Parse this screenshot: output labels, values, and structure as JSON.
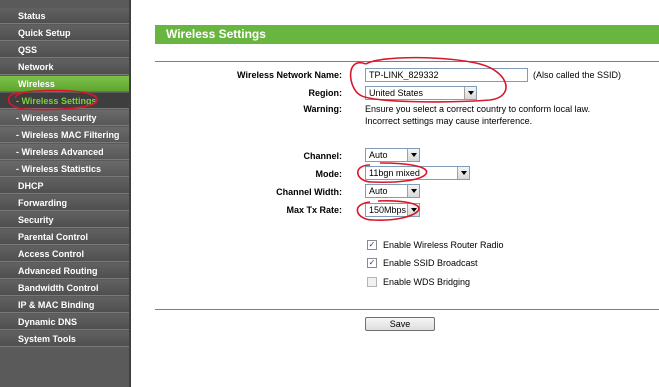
{
  "sidebar": {
    "items": [
      {
        "label": "Status",
        "name": "sidebar-item-status"
      },
      {
        "label": "Quick Setup",
        "name": "sidebar-item-quick-setup"
      },
      {
        "label": "QSS",
        "name": "sidebar-item-qss"
      },
      {
        "label": "Network",
        "name": "sidebar-item-network"
      },
      {
        "label": "Wireless",
        "name": "sidebar-item-wireless"
      },
      {
        "label": "- Wireless Settings",
        "name": "sidebar-item-wireless-settings"
      },
      {
        "label": "- Wireless Security",
        "name": "sidebar-item-wireless-security"
      },
      {
        "label": "- Wireless MAC Filtering",
        "name": "sidebar-item-wireless-mac-filtering"
      },
      {
        "label": "- Wireless Advanced",
        "name": "sidebar-item-wireless-advanced"
      },
      {
        "label": "- Wireless Statistics",
        "name": "sidebar-item-wireless-statistics"
      },
      {
        "label": "DHCP",
        "name": "sidebar-item-dhcp"
      },
      {
        "label": "Forwarding",
        "name": "sidebar-item-forwarding"
      },
      {
        "label": "Security",
        "name": "sidebar-item-security"
      },
      {
        "label": "Parental Control",
        "name": "sidebar-item-parental-control"
      },
      {
        "label": "Access Control",
        "name": "sidebar-item-access-control"
      },
      {
        "label": "Advanced Routing",
        "name": "sidebar-item-advanced-routing"
      },
      {
        "label": "Bandwidth Control",
        "name": "sidebar-item-bandwidth-control"
      },
      {
        "label": "IP & MAC Binding",
        "name": "sidebar-item-ip-mac-binding"
      },
      {
        "label": "Dynamic DNS",
        "name": "sidebar-item-dynamic-dns"
      },
      {
        "label": "System Tools",
        "name": "sidebar-item-system-tools"
      }
    ]
  },
  "page": {
    "title": "Wireless Settings"
  },
  "form": {
    "ssid_label": "Wireless Network Name:",
    "ssid_value": "TP-LINK_829332",
    "ssid_hint": "(Also called the SSID)",
    "region_label": "Region:",
    "region_value": "United States",
    "warning_label": "Warning:",
    "warning_line1": "Ensure you select a correct country to conform local law.",
    "warning_line2": "Incorrect settings may cause interference.",
    "channel_label": "Channel:",
    "channel_value": "Auto",
    "mode_label": "Mode:",
    "mode_value": "11bgn mixed",
    "width_label": "Channel Width:",
    "width_value": "Auto",
    "txrate_label": "Max Tx Rate:",
    "txrate_value": "150Mbps",
    "enable_radio_label": "Enable Wireless Router Radio",
    "enable_radio_checked": "✓",
    "enable_ssid_label": "Enable SSID Broadcast",
    "enable_ssid_checked": "✓",
    "enable_wds_label": "Enable WDS Bridging",
    "save_label": "Save"
  },
  "colors": {
    "accent_green": "#68b63f",
    "sidebar_bg": "#5a5a5a",
    "annotation_red": "#d8182a"
  }
}
